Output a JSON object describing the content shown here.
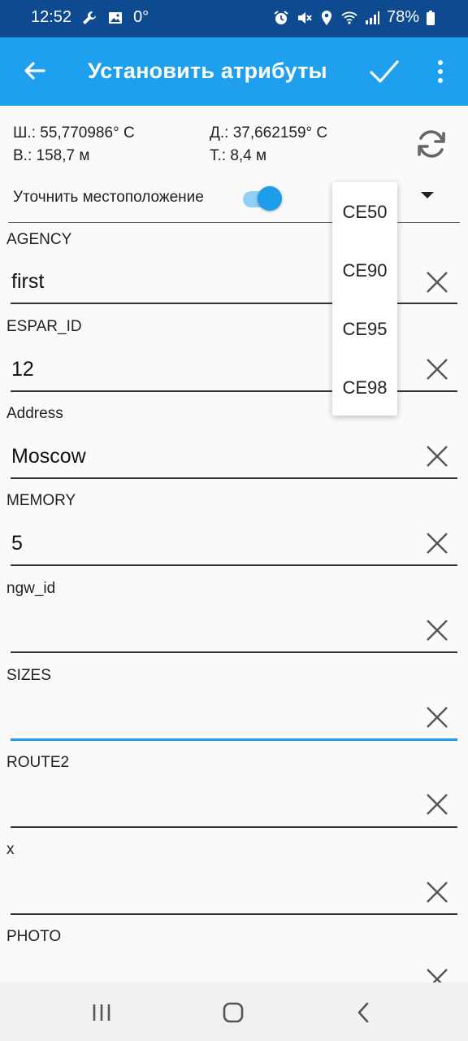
{
  "status_bar": {
    "time": "12:52",
    "temperature": "0°",
    "battery": "78%",
    "left_icons": [
      "wrench-icon",
      "image-icon"
    ],
    "right_icons": [
      "alarm-icon",
      "mute-icon",
      "location-icon",
      "wifi-icon",
      "signal-icon",
      "battery-icon"
    ]
  },
  "app_bar": {
    "title": "Установить атрибуты",
    "background": "#1ea0ef",
    "icons": [
      "back-arrow-icon",
      "check-icon",
      "more-vert-icon"
    ]
  },
  "location": {
    "latitude": "Ш.: 55,770986° С",
    "longitude": "Д.: 37,662159° С",
    "altitude": "В.: 158,7 м",
    "accuracy": "Т.: 8,4 м",
    "refine_label": "Уточнить местоположение",
    "refine_enabled": true
  },
  "accuracy_dropdown": {
    "options": [
      "CE50",
      "CE90",
      "CE95",
      "CE98"
    ]
  },
  "fields": [
    {
      "label": "AGENCY",
      "value": "first"
    },
    {
      "label": "ESPAR_ID",
      "value": "12"
    },
    {
      "label": "Address",
      "value": "Moscow"
    },
    {
      "label": "MEMORY",
      "value": "5"
    },
    {
      "label": "ngw_id",
      "value": ""
    },
    {
      "label": "SIZES",
      "value": "",
      "focused": true
    },
    {
      "label": "ROUTE2",
      "value": ""
    },
    {
      "label": "x",
      "value": ""
    },
    {
      "label": "PHOTO",
      "value": ""
    }
  ],
  "nav_bar": {
    "buttons": [
      "recents-icon",
      "home-icon",
      "back-icon"
    ]
  },
  "colors": {
    "accent": "#1e9cec",
    "status_bar": "#0e4a8f"
  }
}
